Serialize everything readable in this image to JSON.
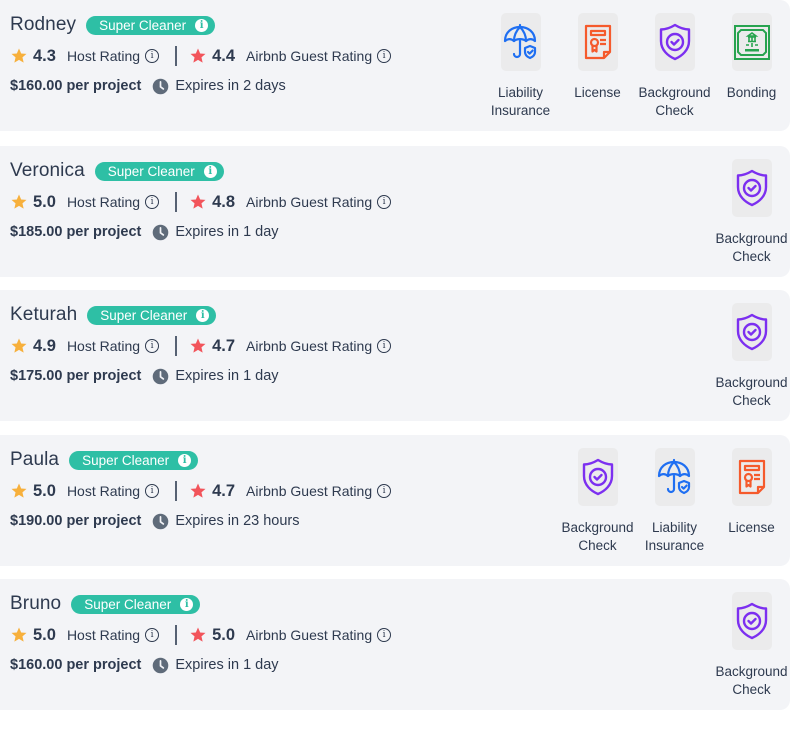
{
  "colors": {
    "card_bg": "#f3f4f7",
    "badge": "#2ebfa5",
    "host_star": "#f7b03c",
    "guest_star": "#f2545b",
    "text": "#2e3a4f",
    "clock": "#5f6b7a",
    "liability_icon": "#1f6ff2",
    "license_icon": "#f55a2c",
    "background_check_icon": "#7c2ff0",
    "bonding_icon": "#27a34f"
  },
  "labels": {
    "badge": "Super Cleaner",
    "host_rating": "Host Rating",
    "guest_rating": "Airbnb Guest Rating",
    "info_glyph": "i"
  },
  "qualifications": {
    "liability": {
      "line1": "Liability",
      "line2": "Insurance",
      "icon": "umbrella-shield-icon"
    },
    "license": {
      "line1": "License",
      "line2": "",
      "icon": "certificate-icon"
    },
    "background": {
      "line1": "Background",
      "line2": "Check",
      "icon": "shield-check-icon"
    },
    "bonding": {
      "line1": "Bonding",
      "line2": "",
      "icon": "bond-certificate-icon"
    }
  },
  "cleaners": [
    {
      "name": "Rodney",
      "host_rating": "4.3",
      "guest_rating": "4.4",
      "price": "$160.00 per project",
      "expires": "Expires in 2 days",
      "quals": [
        "liability",
        "license",
        "background",
        "bonding"
      ]
    },
    {
      "name": "Veronica",
      "host_rating": "5.0",
      "guest_rating": "4.8",
      "price": "$185.00 per project",
      "expires": "Expires in 1 day",
      "quals": [
        "background"
      ]
    },
    {
      "name": "Keturah",
      "host_rating": "4.9",
      "guest_rating": "4.7",
      "price": "$175.00 per project",
      "expires": "Expires in 1 day",
      "quals": [
        "background"
      ]
    },
    {
      "name": "Paula",
      "host_rating": "5.0",
      "guest_rating": "4.7",
      "price": "$190.00 per project",
      "expires": "Expires in 23 hours",
      "quals": [
        "background",
        "liability",
        "license"
      ]
    },
    {
      "name": "Bruno",
      "host_rating": "5.0",
      "guest_rating": "5.0",
      "price": "$160.00 per project",
      "expires": "Expires in 1 day",
      "quals": [
        "background"
      ]
    }
  ]
}
